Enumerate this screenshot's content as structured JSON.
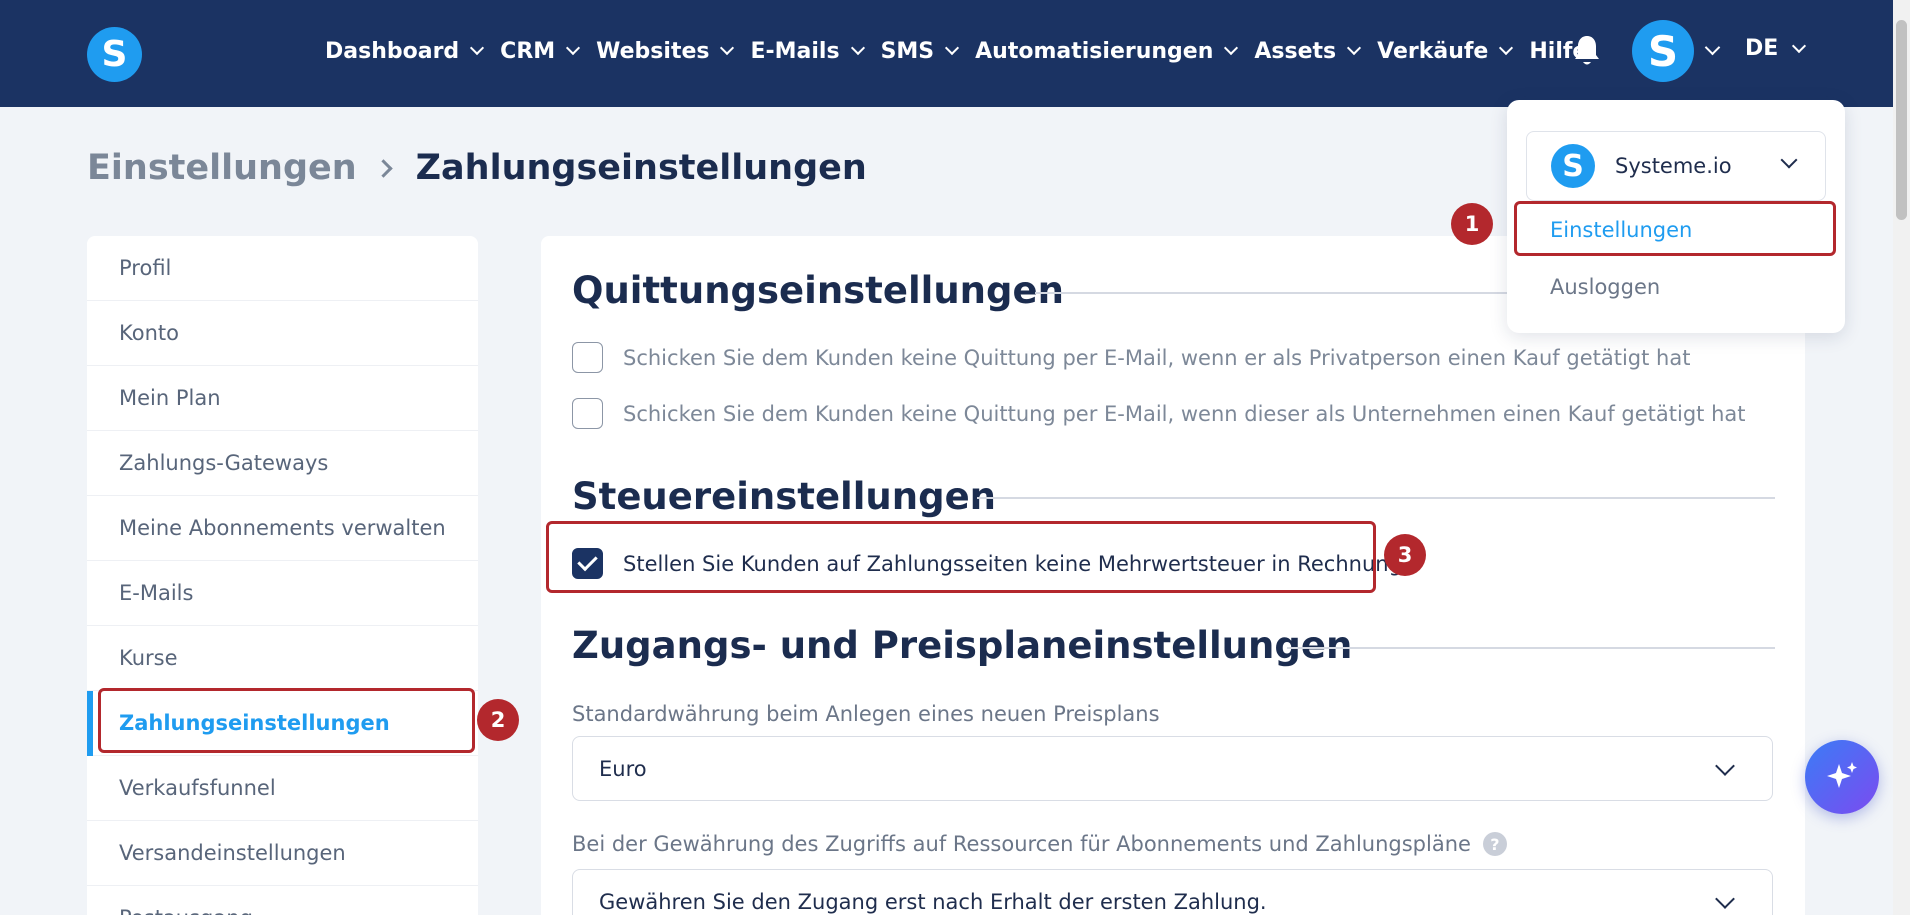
{
  "brand": {
    "logo_letter": "S"
  },
  "nav": {
    "items": [
      {
        "label": "Dashboard",
        "has_dropdown": true
      },
      {
        "label": "CRM",
        "has_dropdown": true
      },
      {
        "label": "Websites",
        "has_dropdown": true
      },
      {
        "label": "E-Mails",
        "has_dropdown": true
      },
      {
        "label": "SMS",
        "has_dropdown": true
      },
      {
        "label": "Automatisierungen",
        "has_dropdown": true
      },
      {
        "label": "Assets",
        "has_dropdown": true
      },
      {
        "label": "Verkäufe",
        "has_dropdown": true
      },
      {
        "label": "Hilfe",
        "has_dropdown": false
      }
    ],
    "avatar_letter": "S",
    "language": "DE"
  },
  "breadcrumb": {
    "parent": "Einstellungen",
    "current": "Zahlungseinstellungen"
  },
  "sidebar": {
    "items": [
      {
        "label": "Profil",
        "active": false
      },
      {
        "label": "Konto",
        "active": false
      },
      {
        "label": "Mein Plan",
        "active": false
      },
      {
        "label": "Zahlungs-Gateways",
        "active": false
      },
      {
        "label": "Meine Abonnements verwalten",
        "active": false
      },
      {
        "label": "E-Mails",
        "active": false
      },
      {
        "label": "Kurse",
        "active": false
      },
      {
        "label": "Zahlungseinstellungen",
        "active": true
      },
      {
        "label": "Verkaufsfunnel",
        "active": false
      },
      {
        "label": "Versandeinstellungen",
        "active": false
      },
      {
        "label": "Postausgang",
        "active": false
      }
    ]
  },
  "main": {
    "receipt": {
      "title": "Quittungseinstellungen",
      "options": [
        {
          "label": "Schicken Sie dem Kunden keine Quittung per E-Mail, wenn er als Privatperson einen Kauf getätigt hat",
          "checked": false
        },
        {
          "label": "Schicken Sie dem Kunden keine Quittung per E-Mail, wenn dieser als Unternehmen einen Kauf getätigt hat",
          "checked": false
        }
      ]
    },
    "tax": {
      "title": "Steuereinstellungen",
      "option": {
        "label": "Stellen Sie Kunden auf Zahlungsseiten keine Mehrwertsteuer in Rechnung",
        "checked": true
      }
    },
    "access": {
      "title": "Zugangs- und Preisplaneinstellungen",
      "currency_label": "Standardwährung beim Anlegen eines neuen Preisplans",
      "currency_value": "Euro",
      "grant_label": "Bei der Gewährung des Zugriffs auf Ressourcen für Abonnements und Zahlungspläne",
      "grant_help": "?",
      "grant_value": "Gewähren Sie den Zugang erst nach Erhalt der ersten Zahlung."
    }
  },
  "account_menu": {
    "account_logo_letter": "S",
    "account_name": "Systeme.io",
    "settings_label": "Einstellungen",
    "logout_label": "Ausloggen"
  },
  "annotations": {
    "marker_1": "1",
    "marker_2": "2",
    "marker_3": "3",
    "color": "#b3282d"
  },
  "colors": {
    "topbar": "#1b3363",
    "accent": "#1f9cf0",
    "checkbox_checked": "#1b3363"
  },
  "icons": {
    "bell": "bell-icon",
    "fab": "sparkles-icon",
    "chevron": "chevron-down-icon"
  }
}
